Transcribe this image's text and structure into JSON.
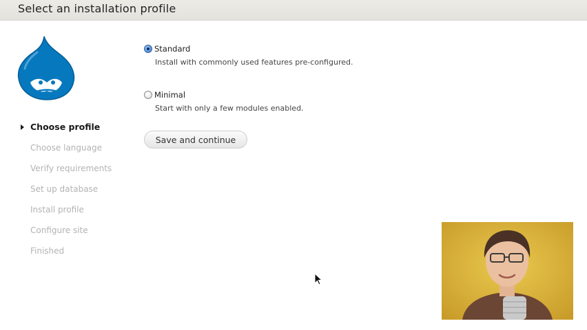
{
  "header": {
    "title": "Select an installation profile"
  },
  "sidebar": {
    "steps": [
      {
        "label": "Choose profile",
        "active": true
      },
      {
        "label": "Choose language",
        "active": false
      },
      {
        "label": "Verify requirements",
        "active": false
      },
      {
        "label": "Set up database",
        "active": false
      },
      {
        "label": "Install profile",
        "active": false
      },
      {
        "label": "Configure site",
        "active": false
      },
      {
        "label": "Finished",
        "active": false
      }
    ]
  },
  "profiles": {
    "standard": {
      "label": "Standard",
      "description": "Install with commonly used features pre-configured.",
      "selected": true
    },
    "minimal": {
      "label": "Minimal",
      "description": "Start with only a few modules enabled.",
      "selected": false
    }
  },
  "actions": {
    "save_label": "Save and continue"
  },
  "colors": {
    "drupal_blue": "#0678be",
    "header_bg": "#e6e5e0",
    "inactive_step": "#b3b3b3",
    "webcam_bg": "#d7b23c"
  }
}
